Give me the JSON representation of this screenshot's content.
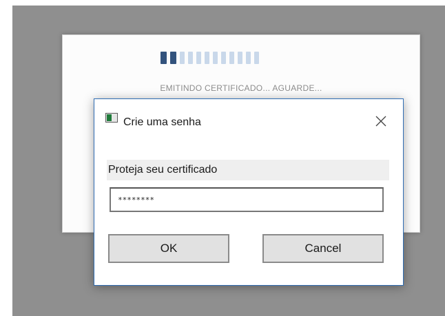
{
  "progress_window": {
    "status_text": "EMITINDO CERTIFICADO... AGUARDE...",
    "progress_segments_total": 12,
    "progress_segments_filled": 2
  },
  "dialog": {
    "title": "Crie uma senha",
    "icon": "certificate-app-icon",
    "close_icon": "close-icon",
    "prompt": "Proteja seu certificado",
    "password_value": "********",
    "ok_label": "OK",
    "cancel_label": "Cancel"
  },
  "colors": {
    "backdrop": "#8f8f8f",
    "progress_filled": "#33537d",
    "progress_empty": "#c9d8ea",
    "dialog_border": "#2f6db4"
  }
}
